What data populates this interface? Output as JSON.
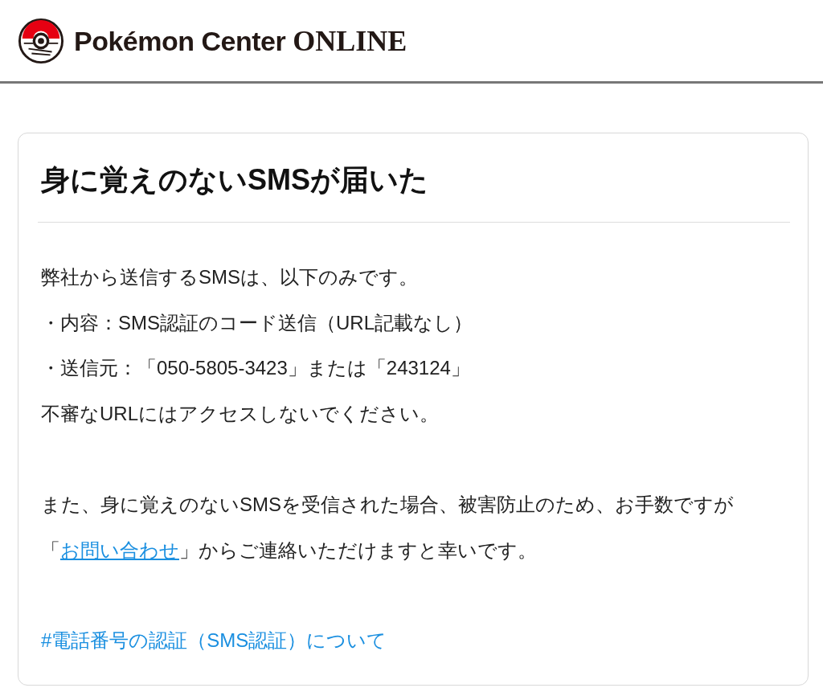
{
  "header": {
    "logo": {
      "brand": "Pokémon Center",
      "suffix": "ONLINE"
    }
  },
  "card": {
    "title": "身に覚えのないSMSが届いた",
    "lines": [
      "弊社から送信するSMSは、以下のみです。",
      "・内容：SMS認証のコード送信（URL記載なし）",
      "・送信元：「050-5805-3423」または「243124」",
      "不審なURLにはアクセスしないでください。"
    ],
    "notice": {
      "text_before": "また、身に覚えのないSMSを受信された場合、被害防止のため、お手数ですが「",
      "link": "お問い合わせ",
      "text_after": "」からご連絡いただけますと幸いです。"
    },
    "anchor_link": "#電話番号の認証（SMS認証）について"
  }
}
